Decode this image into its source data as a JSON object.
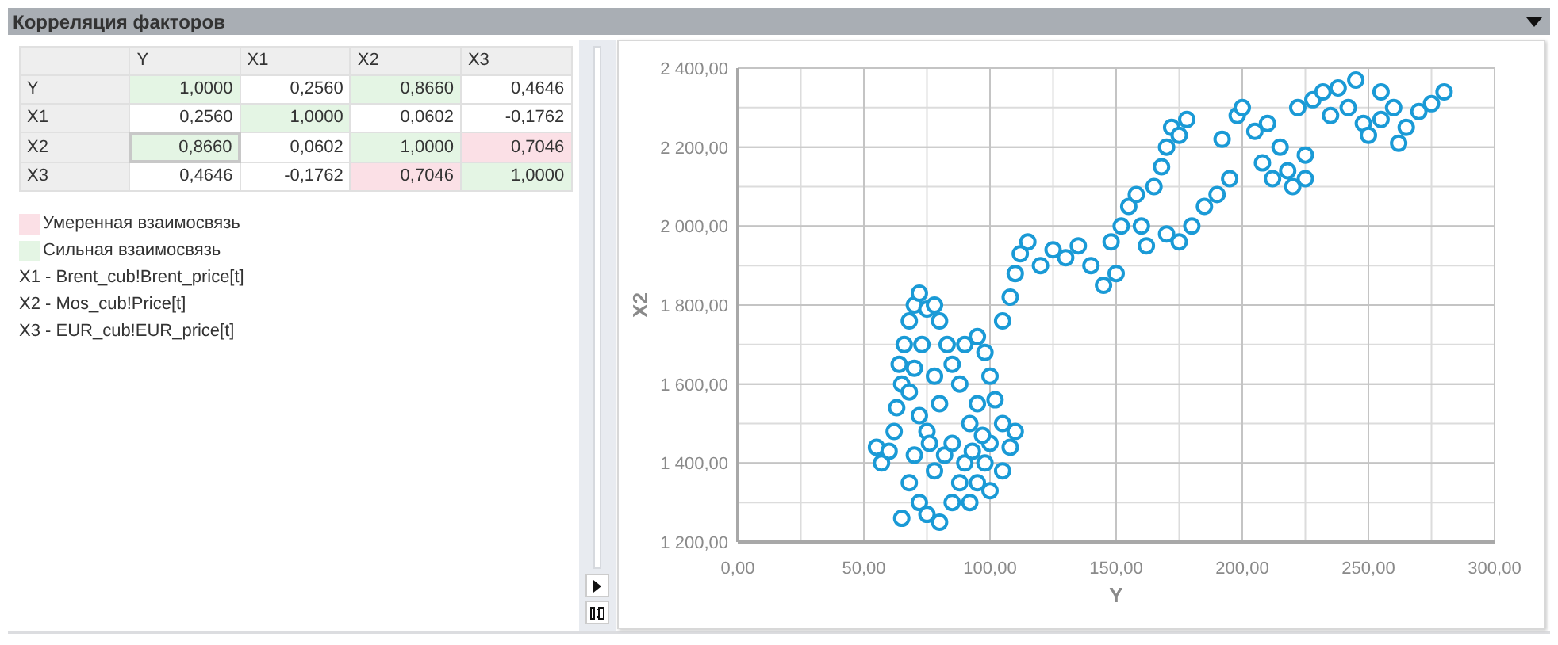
{
  "panel": {
    "title": "Корреляция факторов",
    "expanded": true
  },
  "table": {
    "columns": [
      "Y",
      "X1",
      "X2",
      "X3"
    ],
    "rows": [
      {
        "label": "Y",
        "cells": [
          {
            "value": "1,0000",
            "kind": "strong",
            "selected": false
          },
          {
            "value": "0,2560",
            "kind": "none",
            "selected": false
          },
          {
            "value": "0,8660",
            "kind": "strong",
            "selected": false
          },
          {
            "value": "0,4646",
            "kind": "none",
            "selected": false
          }
        ]
      },
      {
        "label": "X1",
        "cells": [
          {
            "value": "0,2560",
            "kind": "none",
            "selected": false
          },
          {
            "value": "1,0000",
            "kind": "strong",
            "selected": false
          },
          {
            "value": "0,0602",
            "kind": "none",
            "selected": false
          },
          {
            "value": "-0,1762",
            "kind": "none",
            "selected": false
          }
        ]
      },
      {
        "label": "X2",
        "cells": [
          {
            "value": "0,8660",
            "kind": "strong",
            "selected": true
          },
          {
            "value": "0,0602",
            "kind": "none",
            "selected": false
          },
          {
            "value": "1,0000",
            "kind": "strong",
            "selected": false
          },
          {
            "value": "0,7046",
            "kind": "moderate",
            "selected": false
          }
        ]
      },
      {
        "label": "X3",
        "cells": [
          {
            "value": "0,4646",
            "kind": "none",
            "selected": false
          },
          {
            "value": "-0,1762",
            "kind": "none",
            "selected": false
          },
          {
            "value": "0,7046",
            "kind": "moderate",
            "selected": false
          },
          {
            "value": "1,0000",
            "kind": "strong",
            "selected": false
          }
        ]
      }
    ]
  },
  "legend": [
    {
      "kind": "swatch",
      "color": "#fbe0e6",
      "text": "Умеренная взаимосвязь"
    },
    {
      "kind": "swatch",
      "color": "#e4f5e4",
      "text": "Сильная взаимосвязь"
    },
    {
      "kind": "note",
      "text": "X1 - Brent_cub!Brent_price[t]"
    },
    {
      "kind": "note",
      "text": "X2 - Mos_cub!Price[t]"
    },
    {
      "kind": "note",
      "text": "X3 - EUR_cub!EUR_price[t]"
    }
  ],
  "chart": {
    "chart_data": {
      "type": "scatter",
      "grid": true,
      "xlabel": "Y",
      "ylabel": "X2",
      "xlim": [
        0,
        300
      ],
      "ylim": [
        1200,
        2400
      ],
      "xticks": [
        {
          "value": 0,
          "label": "0,00"
        },
        {
          "value": 50,
          "label": "50,00"
        },
        {
          "value": 100,
          "label": "100,00"
        },
        {
          "value": 150,
          "label": "150,00"
        },
        {
          "value": 200,
          "label": "200,00"
        },
        {
          "value": 250,
          "label": "250,00"
        },
        {
          "value": 300,
          "label": "300,00"
        }
      ],
      "yticks": [
        {
          "value": 1200,
          "label": "1 200,00"
        },
        {
          "value": 1400,
          "label": "1 400,00"
        },
        {
          "value": 1600,
          "label": "1 600,00"
        },
        {
          "value": 1800,
          "label": "1 800,00"
        },
        {
          "value": 2000,
          "label": "2 000,00"
        },
        {
          "value": 2200,
          "label": "2 200,00"
        },
        {
          "value": 2400,
          "label": "2 400,00"
        }
      ],
      "x": [
        55,
        57,
        60,
        62,
        63,
        65,
        64,
        66,
        68,
        70,
        72,
        75,
        78,
        80,
        73,
        70,
        68,
        72,
        75,
        70,
        68,
        72,
        75,
        65,
        80,
        85,
        88,
        90,
        82,
        78,
        85,
        92,
        95,
        88,
        85,
        90,
        95,
        98,
        100,
        102,
        105,
        100,
        98,
        95,
        92,
        100,
        105,
        108,
        110,
        80,
        78,
        83,
        76,
        93,
        97,
        105,
        108,
        110,
        112,
        115,
        120,
        125,
        130,
        135,
        140,
        145,
        150,
        148,
        152,
        155,
        158,
        160,
        162,
        165,
        168,
        170,
        172,
        175,
        178,
        180,
        170,
        175,
        185,
        190,
        195,
        192,
        198,
        200,
        205,
        210,
        215,
        212,
        218,
        220,
        225,
        225,
        222,
        228,
        232,
        238,
        245,
        242,
        248,
        250,
        255,
        260,
        265,
        270,
        275,
        280,
        262,
        255,
        235,
        208
      ],
      "series": [
        {
          "color": "#1a9ad6",
          "values": [
            1440,
            1400,
            1430,
            1480,
            1540,
            1600,
            1650,
            1700,
            1760,
            1800,
            1830,
            1790,
            1800,
            1760,
            1700,
            1640,
            1580,
            1520,
            1480,
            1420,
            1350,
            1300,
            1270,
            1260,
            1250,
            1300,
            1350,
            1400,
            1420,
            1380,
            1450,
            1500,
            1550,
            1600,
            1650,
            1700,
            1720,
            1680,
            1620,
            1560,
            1500,
            1450,
            1400,
            1350,
            1300,
            1330,
            1380,
            1440,
            1480,
            1550,
            1620,
            1700,
            1450,
            1430,
            1470,
            1760,
            1820,
            1880,
            1930,
            1960,
            1900,
            1940,
            1920,
            1950,
            1900,
            1850,
            1880,
            1960,
            2000,
            2050,
            2080,
            2000,
            1950,
            2100,
            2150,
            2200,
            2250,
            2230,
            2270,
            2000,
            1980,
            1960,
            2050,
            2080,
            2120,
            2220,
            2280,
            2300,
            2240,
            2260,
            2200,
            2120,
            2140,
            2100,
            2120,
            2180,
            2300,
            2320,
            2340,
            2350,
            2370,
            2300,
            2260,
            2230,
            2270,
            2300,
            2250,
            2290,
            2310,
            2340,
            2210,
            2340,
            2280,
            2160
          ]
        }
      ]
    }
  }
}
